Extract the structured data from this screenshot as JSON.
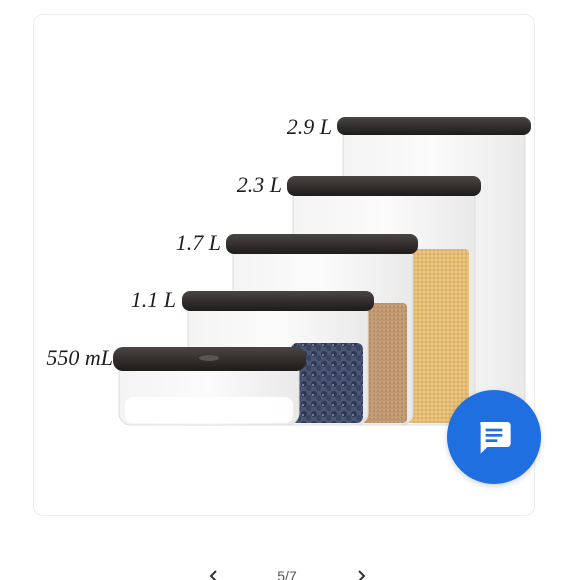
{
  "gallery": {
    "counter": "5/7",
    "prev_icon": "chevron-left-icon",
    "next_icon": "chevron-right-icon"
  },
  "product_image": {
    "size_labels": [
      "2.9 L",
      "2.3 L",
      "1.7 L",
      "1.1 L",
      "550 mL"
    ]
  },
  "chat_button": {
    "icon": "chat-icon",
    "color": "#1f6fe0"
  }
}
